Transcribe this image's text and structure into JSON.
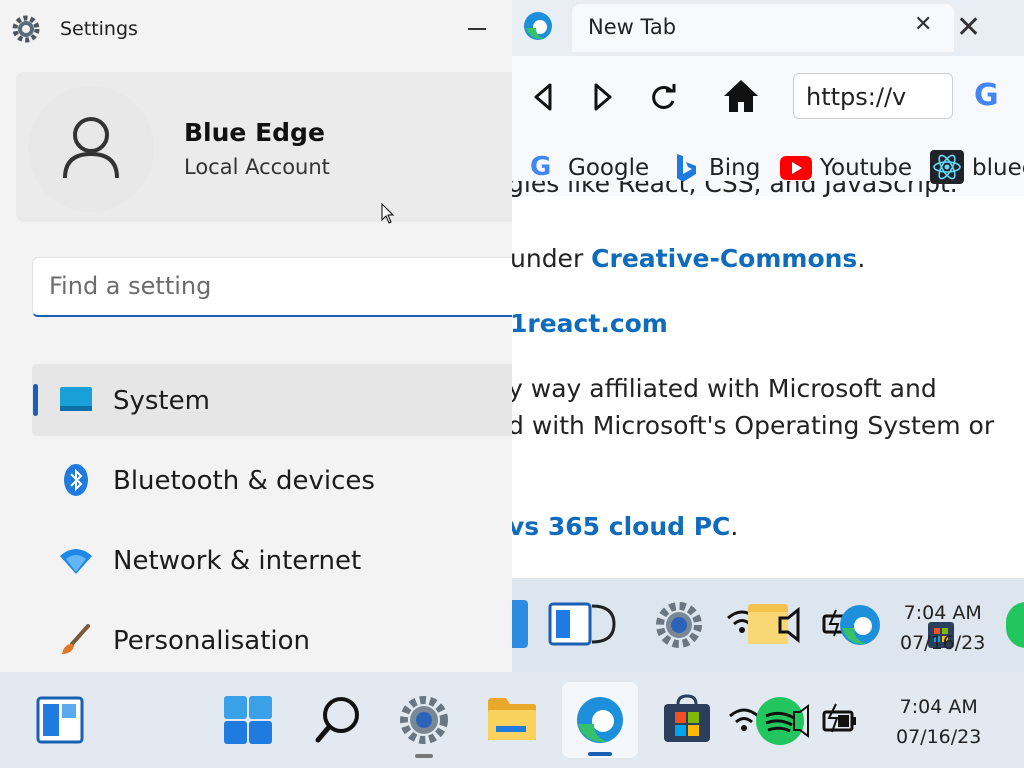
{
  "settings": {
    "title": "Settings",
    "account": {
      "name": "Blue Edge",
      "type": "Local Account"
    },
    "search_placeholder": "Find a setting",
    "nav": [
      {
        "label": "System",
        "icon": "monitor-icon"
      },
      {
        "label": "Bluetooth & devices",
        "icon": "bluetooth-icon"
      },
      {
        "label": "Network & internet",
        "icon": "wifi-icon"
      },
      {
        "label": "Personalisation",
        "icon": "brush-icon"
      }
    ]
  },
  "edge": {
    "tab_title": "New Tab",
    "url": "https://v",
    "bookmarks": [
      {
        "label": "Google",
        "icon": "google-icon"
      },
      {
        "label": "Bing",
        "icon": "bing-icon"
      },
      {
        "label": "Youtube",
        "icon": "youtube-icon"
      },
      {
        "label": "bluee",
        "icon": "react-icon"
      }
    ],
    "content": {
      "line1": "gies like React, CSS, and JavaScript.",
      "line2_prefix": "under ",
      "line2_link": "Creative-Commons",
      "line2_suffix": ".",
      "line3_link": "1react.com",
      "line4": "y way affiliated with Microsoft and",
      "line5": "d with Microsoft's Operating System or",
      "line6_link": "vs 365 cloud PC",
      "line6_suffix": "."
    },
    "mini_clock": {
      "time": "7:04 AM",
      "date": "07/16/23"
    }
  },
  "taskbar": {
    "clock": {
      "time": "7:04 AM",
      "date": "07/16/23"
    }
  },
  "colors": {
    "accent": "#1a5fb4",
    "link": "#0f6cbd"
  }
}
